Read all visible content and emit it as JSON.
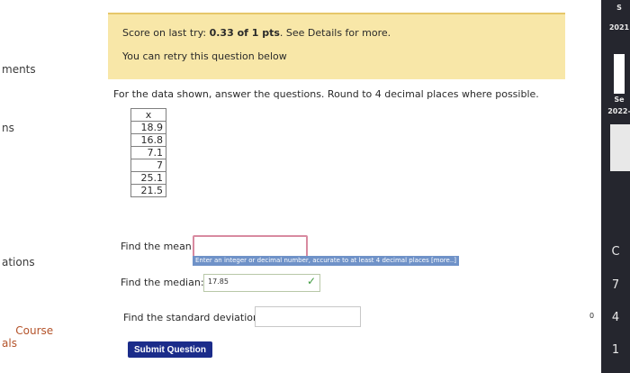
{
  "sidebar": {
    "items": [
      {
        "label": "ments"
      },
      {
        "label": "ns"
      },
      {
        "label": "ations"
      },
      {
        "label": "Course\nals"
      }
    ]
  },
  "notice": {
    "score_prefix": "Score on last try: ",
    "score_value": "0.33 of 1 pts",
    "score_suffix": ". See Details for more.",
    "retry": "You can retry this question below"
  },
  "question": {
    "instructions": "For the data shown, answer the questions. Round to 4 decimal places where possible.",
    "table": {
      "header": "x",
      "values": [
        "18.9",
        "16.8",
        "7.1",
        "7",
        "25.1",
        "21.5"
      ]
    },
    "mean_label": "Find the mean:",
    "mean_value": "",
    "tooltip": "Enter an integer or decimal number, accurate to at least 4 decimal places [more..]",
    "median_label": "Find the median:",
    "median_value": "17.85",
    "sd_label": "Find the standard deviation:",
    "sd_value": "",
    "submit_label": "Submit Question"
  },
  "right_panel": {
    "line1": "S",
    "line2": "2021",
    "line3": "Se",
    "line4": "2022-",
    "letter": "C",
    "n1": "7",
    "n2": "4",
    "n3": "1"
  },
  "misc": {
    "dot": "0"
  }
}
